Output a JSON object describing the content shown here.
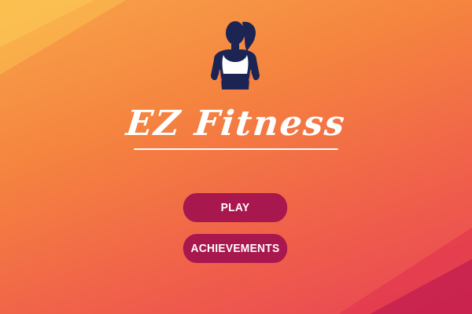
{
  "app": {
    "title": "EZ Fitness",
    "logo_icon": "woman-athlete-icon"
  },
  "menu": {
    "play_label": "PLAY",
    "achievements_label": "ACHIEVEMENTS"
  },
  "colors": {
    "background_top": "#f8a44a",
    "background_bottom": "#e84454",
    "button": "#a8174e",
    "logo_figure": "#1b2453",
    "text": "#ffffff"
  }
}
